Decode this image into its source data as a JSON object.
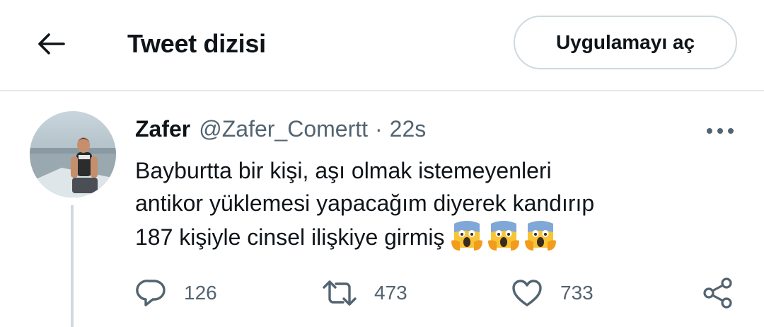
{
  "header": {
    "title": "Tweet dizisi",
    "open_app_label": "Uygulamayı aç"
  },
  "tweet": {
    "author_name": "Zafer",
    "handle": "@Zafer_Comertt",
    "separator": "·",
    "time": "22s",
    "text_lines": [
      "Bayburtta bir kişi, aşı olmak istemeyenleri",
      "antikor yüklemesi yapacağım diyerek kandırıp",
      "187 kişiyle cinsel ilişkiye girmiş"
    ],
    "emojis": [
      "face-screaming-in-fear",
      "face-screaming-in-fear",
      "face-screaming-in-fear"
    ],
    "stats": {
      "replies": "126",
      "retweets": "473",
      "likes": "733"
    }
  },
  "colors": {
    "text_primary": "#0f1419",
    "text_secondary": "#536471",
    "border": "#cfd9de",
    "divider": "#e1e8ed"
  }
}
